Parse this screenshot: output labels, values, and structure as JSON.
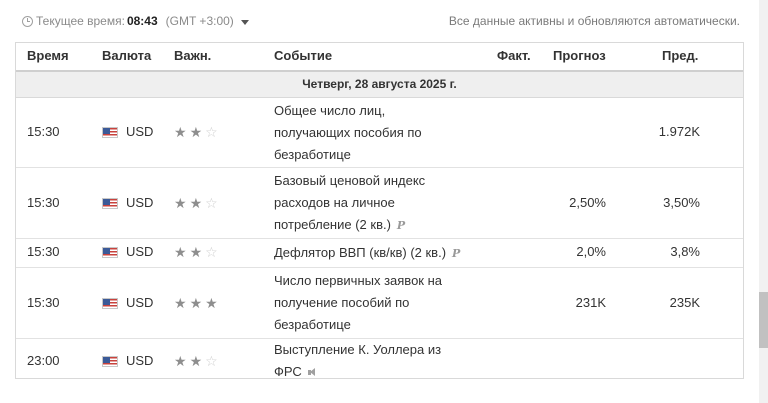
{
  "topbar": {
    "clock_icon": "clock-icon",
    "current_time_label": "Текущее время:",
    "current_time_value": "08:43",
    "timezone": "(GMT +3:00)",
    "auto_update_note": "Все данные активны и обновляются автоматически."
  },
  "table": {
    "headers": {
      "time": "Время",
      "currency": "Валюта",
      "importance": "Важн.",
      "event": "Событие",
      "actual": "Факт.",
      "forecast": "Прогноз",
      "previous": "Пред."
    },
    "day_label": "Четверг, 28 августа 2025 г.",
    "rows": [
      {
        "time": "15:30",
        "flag": "us-flag-icon",
        "currency": "USD",
        "importance": 2,
        "event_lines": [
          "Общее число лиц,",
          "получающих пособия по",
          "безработице"
        ],
        "actual": "",
        "forecast": "",
        "previous": "1.972K"
      },
      {
        "time": "15:30",
        "flag": "us-flag-icon",
        "currency": "USD",
        "importance": 2,
        "event_lines": [
          "Базовый ценовой индекс",
          "расходов на личное",
          "потребление (2 кв.)"
        ],
        "preliminary_mark": "P",
        "actual": "",
        "forecast": "2,50%",
        "previous": "3,50%"
      },
      {
        "time": "15:30",
        "flag": "us-flag-icon",
        "currency": "USD",
        "importance": 2,
        "event_lines": [
          "Дефлятор ВВП (кв/кв) (2 кв.)"
        ],
        "preliminary_mark": "P",
        "actual": "",
        "forecast": "2,0%",
        "previous": "3,8%"
      },
      {
        "time": "15:30",
        "flag": "us-flag-icon",
        "currency": "USD",
        "importance": 3,
        "event_lines": [
          "Число первичных заявок на",
          "получение пособий по",
          "безработице"
        ],
        "actual": "",
        "forecast": "231K",
        "previous": "235K"
      },
      {
        "time": "23:00",
        "flag": "us-flag-icon",
        "currency": "USD",
        "importance": 2,
        "event_lines": [
          "Выступление К. Уоллера из",
          "ФРС"
        ],
        "speech_icon": "speaker-icon",
        "actual": "",
        "forecast": "",
        "previous": ""
      }
    ]
  }
}
